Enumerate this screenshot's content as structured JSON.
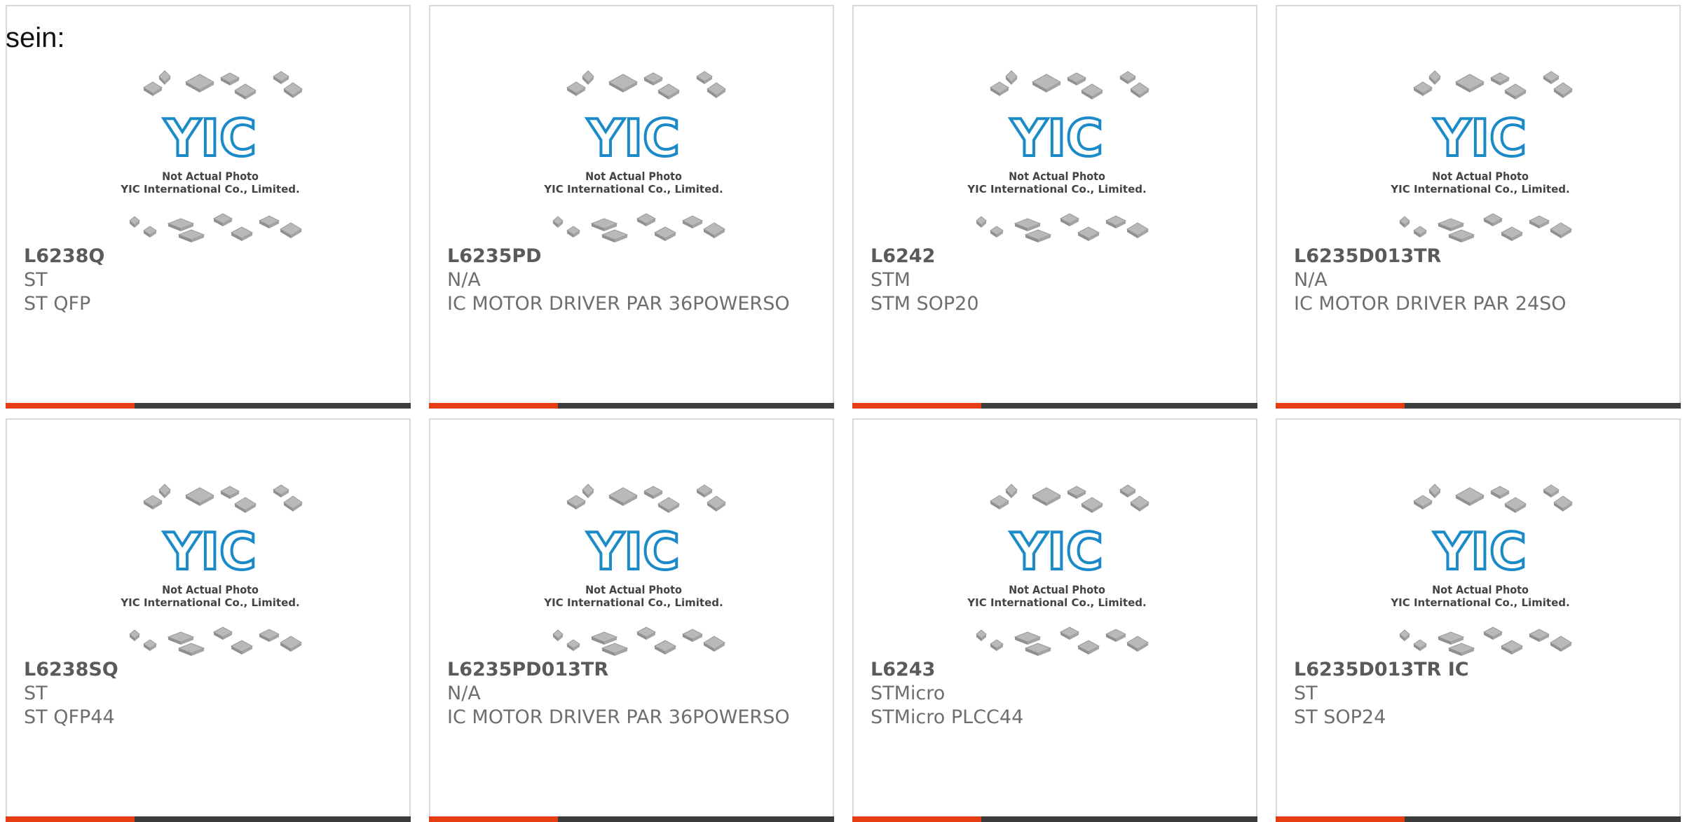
{
  "heading": "sein:",
  "placeholder": {
    "line1": "Not Actual Photo",
    "line2": "YIC International Co., Limited.",
    "logo_text": "YIC",
    "logo_color": "#1a8ac8"
  },
  "colors": {
    "accent": "#e63c14",
    "bar": "#3c3c3c",
    "border": "#d9d9d9"
  },
  "products": [
    {
      "part": "L6238Q",
      "brand": "ST",
      "desc": "ST QFP"
    },
    {
      "part": "L6235PD",
      "brand": "N/A",
      "desc": "IC MOTOR DRIVER PAR 36POWERSO"
    },
    {
      "part": "L6242",
      "brand": "STM",
      "desc": "STM SOP20"
    },
    {
      "part": "L6235D013TR",
      "brand": "N/A",
      "desc": "IC MOTOR DRIVER PAR 24SO"
    },
    {
      "part": "L6238SQ",
      "brand": "ST",
      "desc": "ST QFP44"
    },
    {
      "part": "L6235PD013TR",
      "brand": "N/A",
      "desc": "IC MOTOR DRIVER PAR 36POWERSO"
    },
    {
      "part": "L6243",
      "brand": "STMicro",
      "desc": "STMicro PLCC44"
    },
    {
      "part": "L6235D013TR IC",
      "brand": "ST",
      "desc": "ST SOP24"
    }
  ]
}
